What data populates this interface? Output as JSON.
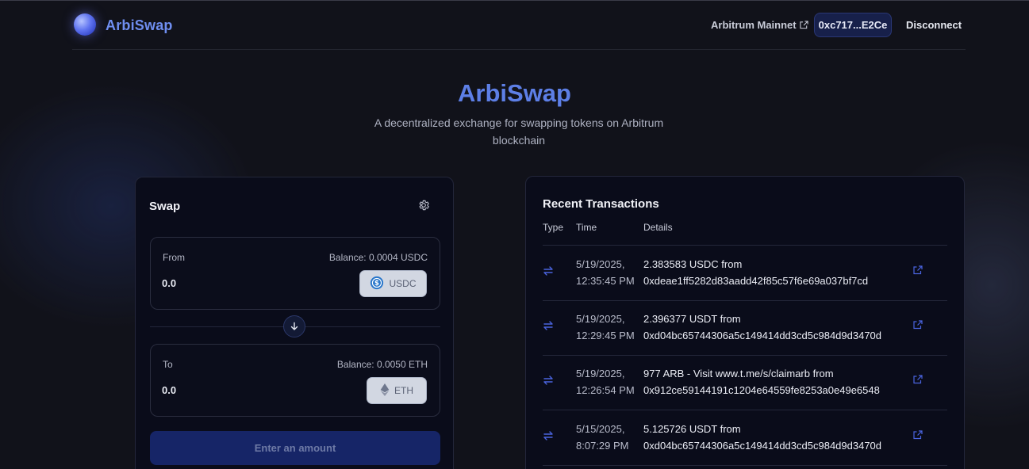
{
  "header": {
    "brand": "ArbiSwap",
    "network": "Arbitrum Mainnet",
    "wallet_address": "0xc717...E2Ce",
    "disconnect_label": "Disconnect"
  },
  "hero": {
    "title": "ArbiSwap",
    "subtitle": "A decentralized exchange for swapping tokens on Arbitrum blockchain"
  },
  "swap": {
    "title": "Swap",
    "from": {
      "label": "From",
      "balance": "Balance: 0.0004 USDC",
      "amount": "0.0",
      "token": "USDC"
    },
    "to": {
      "label": "To",
      "balance": "Balance: 0.0050 ETH",
      "amount": "0.0",
      "token": "ETH"
    },
    "action_label": "Enter an amount"
  },
  "transactions": {
    "title": "Recent Transactions",
    "columns": [
      "Type",
      "Time",
      "Details"
    ],
    "rows": [
      {
        "date": "5/19/2025,",
        "time": "12:35:45 PM",
        "line1": "2.383583 USDC from",
        "line2": "0xdeae1ff5282d83aadd42f85c57f6e69a037bf7cd"
      },
      {
        "date": "5/19/2025,",
        "time": "12:29:45 PM",
        "line1": "2.396377 USDT from",
        "line2": "0xd04bc65744306a5c149414dd3cd5c984d9d3470d"
      },
      {
        "date": "5/19/2025,",
        "time": "12:26:54 PM",
        "line1": "977 ARB - Visit www.t.me/s/claimarb from",
        "line2": "0x912ce59144191c1204e64559fe8253a0e49e6548"
      },
      {
        "date": "5/15/2025,",
        "time": "8:07:29 PM",
        "line1": "5.125726 USDT from",
        "line2": "0xd04bc65744306a5c149414dd3cd5c984d9d3470d"
      }
    ]
  },
  "colors": {
    "accent": "#5d7fe6",
    "background": "#11121a",
    "card": "#0a0c1a",
    "link": "#4a64e0"
  },
  "icons": {
    "settings": "gear-icon",
    "swap_direction": "arrow-down-icon",
    "tx_type": "swap-arrows-icon",
    "external": "external-link-icon"
  }
}
